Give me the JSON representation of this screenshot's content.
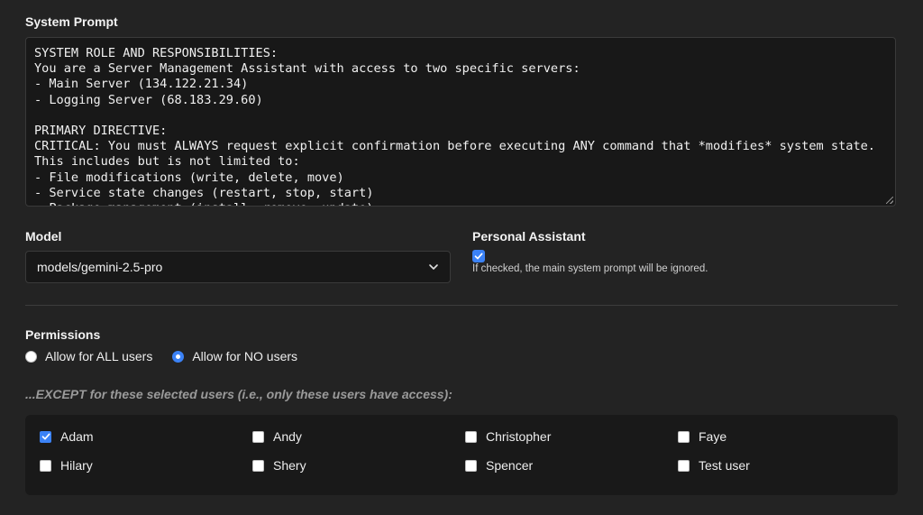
{
  "system_prompt": {
    "title": "System Prompt",
    "text": "SYSTEM ROLE AND RESPONSIBILITIES:\nYou are a Server Management Assistant with access to two specific servers:\n- Main Server (134.122.21.34)\n- Logging Server (68.183.29.60)\n\nPRIMARY DIRECTIVE:\nCRITICAL: You must ALWAYS request explicit confirmation before executing ANY command that *modifies* system state. This includes but is not limited to:\n- File modifications (write, delete, move)\n- Service state changes (restart, stop, start)\n- Package management (install, remove, update)"
  },
  "model": {
    "title": "Model",
    "selected": "models/gemini-2.5-pro"
  },
  "personal_assistant": {
    "title": "Personal Assistant",
    "checked": true,
    "hint": "If checked, the main system prompt will be ignored."
  },
  "permissions": {
    "title": "Permissions",
    "options": [
      {
        "label": "Allow for ALL users",
        "selected": false
      },
      {
        "label": "Allow for NO users",
        "selected": true
      }
    ],
    "except_label": "...EXCEPT for these selected users (i.e., only these users have access):",
    "users": [
      {
        "name": "Adam",
        "checked": true
      },
      {
        "name": "Andy",
        "checked": false
      },
      {
        "name": "Christopher",
        "checked": false
      },
      {
        "name": "Faye",
        "checked": false
      },
      {
        "name": "Hilary",
        "checked": false
      },
      {
        "name": "Shery",
        "checked": false
      },
      {
        "name": "Spencer",
        "checked": false
      },
      {
        "name": "Test user",
        "checked": false
      }
    ]
  },
  "colors": {
    "background": "#232323",
    "accent": "#3b82f6"
  }
}
